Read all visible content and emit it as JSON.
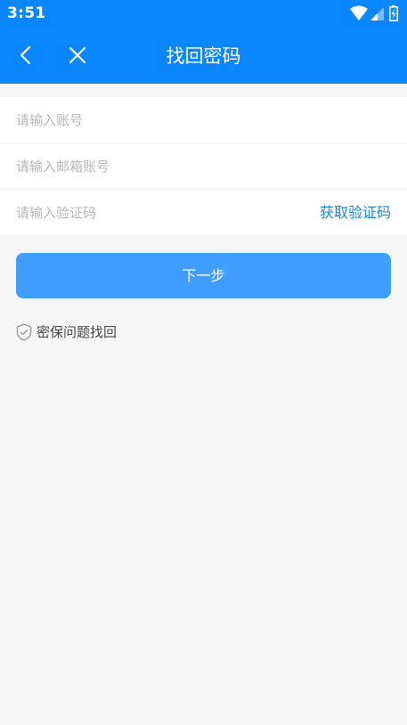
{
  "status_bar": {
    "time": "3:51",
    "icons": [
      "wifi-icon",
      "cell-signal-icon",
      "battery-charging-icon"
    ]
  },
  "header": {
    "title": "找回密码",
    "back_icon": "chevron-left-icon",
    "close_icon": "close-icon",
    "background": "#0a86ff"
  },
  "form": {
    "account_placeholder": "请输入账号",
    "email_placeholder": "请输入邮箱账号",
    "code_placeholder": "请输入验证码",
    "get_code_label": "获取验证码",
    "get_code_color": "#1a84e6"
  },
  "actions": {
    "next_label": "下一步",
    "next_color": "#409eff"
  },
  "security": {
    "label": "密保问题找回",
    "icon": "shield-check-icon"
  }
}
